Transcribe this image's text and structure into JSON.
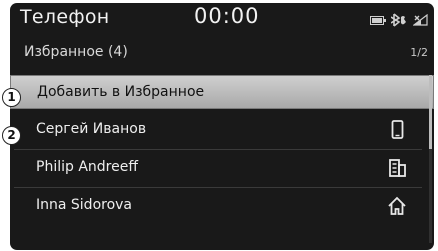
{
  "statusbar": {
    "app_title": "Телефон",
    "time": "00:00",
    "icons": [
      "battery-icon",
      "bluetooth-phone-icon",
      "signal-strength-icon"
    ]
  },
  "header": {
    "title": "Избранное (4)",
    "page": "1/2"
  },
  "markers": {
    "first": "1",
    "second": "2"
  },
  "list": {
    "items": [
      {
        "label": "Добавить в Избранное",
        "icon": null,
        "selected": true
      },
      {
        "label": "Сергей Иванов",
        "icon": "mobile-phone-icon",
        "selected": false
      },
      {
        "label": "Philip Andreeff",
        "icon": "office-phone-icon",
        "selected": false
      },
      {
        "label": "Inna Sidorova",
        "icon": "home-icon",
        "selected": false
      }
    ]
  },
  "colors": {
    "background": "#191919",
    "selected_row": "#c4c4c4",
    "text": "#eeeeee"
  }
}
